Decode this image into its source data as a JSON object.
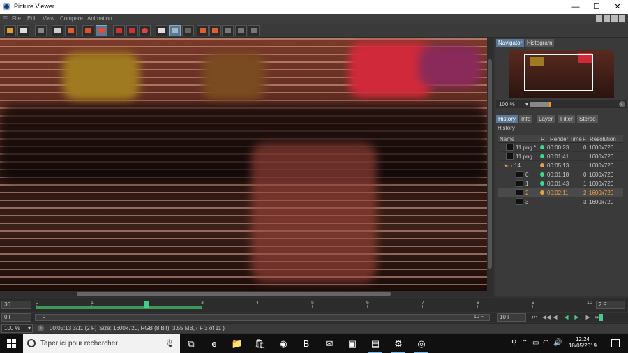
{
  "window": {
    "title": "Picture Viewer",
    "minimize": "—",
    "maximize": "☐",
    "close": "✕"
  },
  "menu": {
    "grip": "☰",
    "items": [
      "File",
      "Edit",
      "View",
      "Compare",
      "Animation"
    ]
  },
  "navigator": {
    "tabs": [
      "Navigator",
      "Histogram"
    ],
    "zoom": "100 %",
    "zoom_arrow": "▾",
    "go": "›"
  },
  "panel": {
    "tabs": [
      "History",
      "Info",
      "Layer",
      "Filter",
      "Stereo"
    ],
    "header": "History",
    "columns": [
      "Name",
      "R",
      "Render Time",
      "F",
      "Resolution"
    ],
    "rows": [
      {
        "name": "11.png *",
        "status_color": "#33e08a",
        "time": "00:00:23",
        "f": "0",
        "res": "1600x720"
      },
      {
        "name": "11.png",
        "status_color": "#33e08a",
        "time": "00:01:41",
        "f": "",
        "res": "1600x720"
      },
      {
        "name": "14",
        "status_color": "#e8a040",
        "time": "00:05:13",
        "f": "",
        "res": "1600x720",
        "folder": true
      },
      {
        "name": "0",
        "status_color": "#33e08a",
        "time": "00:01:18",
        "f": "0",
        "res": "1600x720"
      },
      {
        "name": "1",
        "status_color": "#33e08a",
        "time": "00:01:43",
        "f": "1",
        "res": "1600x720"
      },
      {
        "name": "2",
        "status_color": "#e8a040",
        "time": "00:02:11",
        "f": "2",
        "res": "1600x720",
        "selected": true
      },
      {
        "name": "3",
        "status_color": "",
        "time": "",
        "f": "3",
        "res": "1600x720"
      }
    ]
  },
  "timeline": {
    "fps": "30",
    "end_frame": "2 F",
    "ticks": [
      "0",
      "1",
      "2",
      "3",
      "4",
      "5",
      "6",
      "7",
      "8",
      "9",
      "10"
    ],
    "playhead_frame": 2,
    "loaded_until_frame": 3
  },
  "playback": {
    "current_frame": "0 F",
    "range_start": "0",
    "range_end": "10 F",
    "total_frames": "10 F",
    "buttons": [
      "⏮",
      "◀◀",
      "◀|",
      "◀",
      "▶",
      "|▶",
      "⏭"
    ]
  },
  "status": {
    "zoom": "100 %",
    "arrow": "▾",
    "nav": "›",
    "render_info": "00:05:13 3/11 (2 F)",
    "image_info": "Size: 1600x720, RGB (8 Bit), 3.55 MB,  ( F 3 of 11 )"
  },
  "taskbar": {
    "search_placeholder": "Taper ici pour rechercher",
    "time": "12:24",
    "date": "18/05/2019",
    "apps": [
      {
        "icon": "task-view-icon",
        "glyph": "⧉"
      },
      {
        "icon": "edge-icon",
        "glyph": "e"
      },
      {
        "icon": "file-explorer-icon",
        "glyph": "📁"
      },
      {
        "icon": "store-icon",
        "glyph": "🛍"
      },
      {
        "icon": "firefox-icon",
        "glyph": "◉"
      },
      {
        "icon": "b-app-icon",
        "glyph": "B"
      },
      {
        "icon": "mail-icon",
        "glyph": "✉"
      },
      {
        "icon": "photos-icon",
        "glyph": "▣"
      },
      {
        "icon": "render-app-icon",
        "glyph": "▤"
      },
      {
        "icon": "settings-icon",
        "glyph": "⚙"
      },
      {
        "icon": "cinema4d-icon",
        "glyph": "◎"
      }
    ],
    "tray": [
      "person-icon",
      "chevron-up-icon",
      "network-icon",
      "wifi-icon",
      "volume-icon",
      "notifications-icon"
    ],
    "tray_glyphs": [
      "⚲",
      "⌃",
      "▭",
      "◠",
      "🔊",
      "☐"
    ]
  },
  "colors": {
    "accent": "#5a7896",
    "loaded": "#3f9a5a",
    "render_ok": "#33e08a",
    "render_active": "#e8a040"
  }
}
